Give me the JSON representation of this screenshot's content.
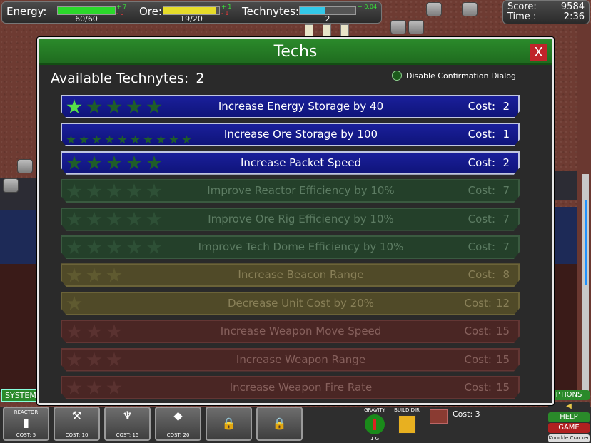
{
  "hud": {
    "energy_label": "Energy:",
    "energy_value": "60/60",
    "energy_fill": 1.0,
    "energy_rate_pos": "+ 7",
    "energy_rate_neg": "- 0",
    "ore_label": "Ore:",
    "ore_value": "19/20",
    "ore_fill": 0.95,
    "ore_rate_pos": "+ 1",
    "ore_rate_neg": "- 1",
    "technytes_label": "Technytes:",
    "technytes_value": "2",
    "technytes_fill": 0.45,
    "technytes_rate_pos": "+ 0.04"
  },
  "score": {
    "score_label": "Score:",
    "score_value": "9584",
    "time_label": "Time :",
    "time_value": "2:36"
  },
  "dialog": {
    "title": "Techs",
    "close_label": "X",
    "available_label": "Available Technytes:",
    "available_value": "2",
    "disable_confirm_label": "Disable Confirmation Dialog",
    "cost_label": "Cost:",
    "techs": [
      {
        "name": "Increase Energy Storage by 40",
        "cost": "2",
        "style": "blue",
        "stars": 5,
        "stars_on": 1
      },
      {
        "name": "Increase Ore Storage by 100",
        "cost": "1",
        "style": "blue",
        "stars": 10,
        "stars_on": 0,
        "mini": true
      },
      {
        "name": "Increase Packet Speed",
        "cost": "2",
        "style": "blue",
        "stars": 5,
        "stars_on": 0
      },
      {
        "name": "Improve Reactor Efficiency by 10%",
        "cost": "7",
        "style": "green",
        "stars": 5,
        "stars_on": 0
      },
      {
        "name": "Improve Ore Rig Efficiency by 10%",
        "cost": "7",
        "style": "green",
        "stars": 5,
        "stars_on": 0
      },
      {
        "name": "Improve Tech Dome Efficiency by 10%",
        "cost": "7",
        "style": "green",
        "stars": 5,
        "stars_on": 0
      },
      {
        "name": "Increase Beacon Range",
        "cost": "8",
        "style": "olive",
        "stars": 3,
        "stars_on": 0
      },
      {
        "name": "Decrease Unit Cost by 20%",
        "cost": "12",
        "style": "olive",
        "stars": 1,
        "stars_on": 0
      },
      {
        "name": "Increase Weapon Move Speed",
        "cost": "15",
        "style": "red",
        "stars": 3,
        "stars_on": 0
      },
      {
        "name": "Increase Weapon Range",
        "cost": "15",
        "style": "red",
        "stars": 3,
        "stars_on": 0
      },
      {
        "name": "Increase Weapon Fire Rate",
        "cost": "15",
        "style": "red",
        "stars": 3,
        "stars_on": 0
      }
    ]
  },
  "bottom": {
    "systems_label": "SYSTEM",
    "slots": [
      {
        "title": "REACTOR",
        "cost": "COST: 5",
        "icon": "reactor-icon",
        "glyph": "▮"
      },
      {
        "title": "",
        "cost": "COST: 10",
        "icon": "ore-rig-icon",
        "glyph": "⚒"
      },
      {
        "title": "",
        "cost": "COST: 15",
        "icon": "weapon-icon",
        "glyph": "♆"
      },
      {
        "title": "",
        "cost": "COST: 20",
        "icon": "tech-dome-icon",
        "glyph": "◆"
      },
      {
        "title": "",
        "cost": "",
        "icon": "lock-icon",
        "glyph": "🔒"
      },
      {
        "title": "",
        "cost": "",
        "icon": "lock-icon",
        "glyph": "🔒"
      }
    ],
    "gravity_label": "GRAVITY",
    "gravity_value": "1 G",
    "build_dir_label": "BUILD DIR",
    "ground_cost": "Cost: 3",
    "options_label": "PTIONS",
    "help_label": "HELP",
    "game_label": "GAME",
    "credit_label": "Knuckle Cracker"
  }
}
